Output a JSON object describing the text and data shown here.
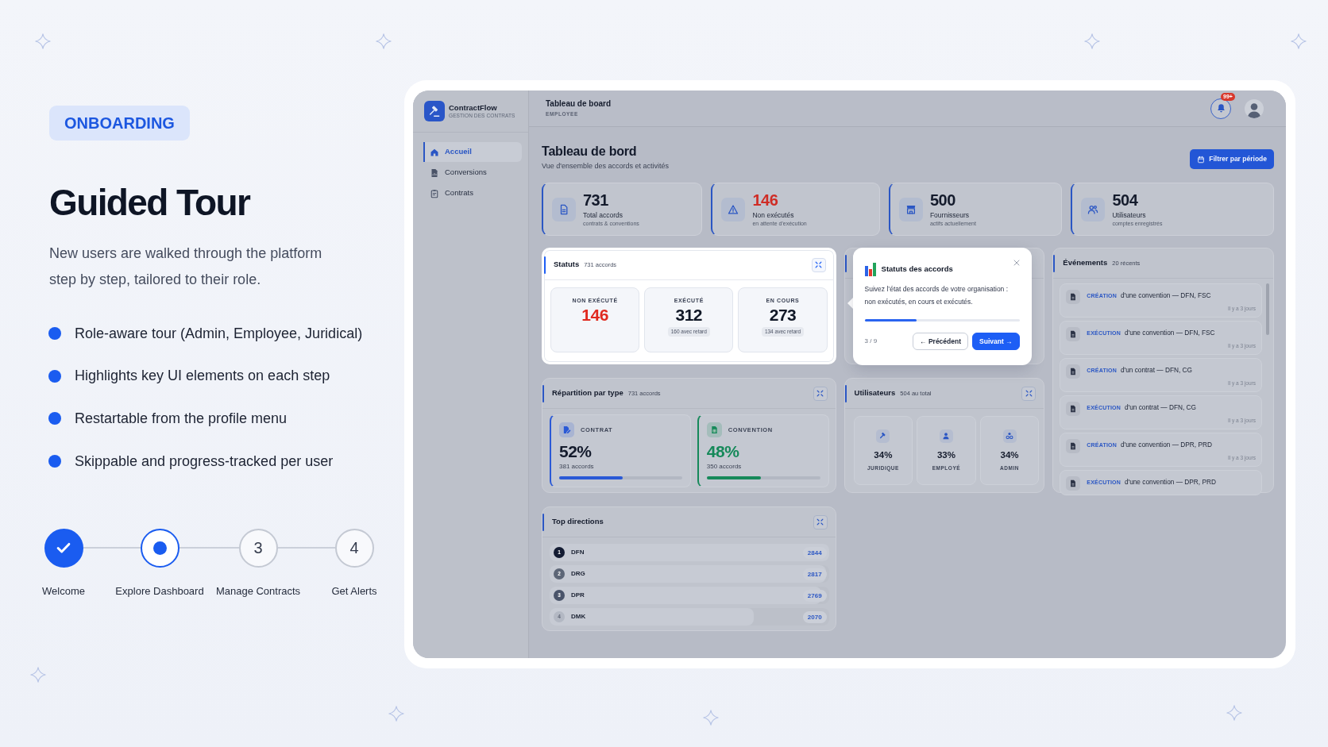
{
  "intro": {
    "badge": "ONBOARDING",
    "title": "Guided Tour",
    "description": "New users are walked through the platform step by step, tailored to their role.",
    "features": [
      "Role-aware tour (Admin, Employee, Juridical)",
      "Highlights key UI elements on each step",
      "Restartable from the profile menu",
      "Skippable and progress-tracked per user"
    ]
  },
  "steps": [
    {
      "label": "Welcome",
      "done": true,
      "current": false
    },
    {
      "label": "Explore Dashboard",
      "done": false,
      "current": true
    },
    {
      "number": "3",
      "label": "Manage Contracts",
      "done": false,
      "current": false
    },
    {
      "number": "4",
      "label": "Get Alerts",
      "done": false,
      "current": false
    }
  ],
  "app": {
    "brand": {
      "name": "ContractFlow",
      "tagline": "GESTION DES CONTRATS"
    },
    "nav": [
      {
        "label": "Accueil",
        "selected": true
      },
      {
        "label": "Conversions",
        "selected": false
      },
      {
        "label": "Contrats",
        "selected": false
      }
    ],
    "header": {
      "title": "Tableau de board",
      "role": "EMPLOYEE",
      "notifications": "99+"
    },
    "page": {
      "title": "Tableau de bord",
      "subtitle": "Vue d'ensemble des accords et activités",
      "filter_button": "Filtrer par période"
    },
    "kpis": [
      {
        "value": "731",
        "label": "Total accords",
        "note": "contrats & conventions",
        "alert": false
      },
      {
        "value": "146",
        "label": "Non exécutés",
        "note": "en attente d'exécution",
        "alert": true
      },
      {
        "value": "500",
        "label": "Fournisseurs",
        "note": "actifs actuellement",
        "alert": false
      },
      {
        "value": "504",
        "label": "Utilisateurs",
        "note": "comptes enregistrés",
        "alert": false
      }
    ],
    "statuts": {
      "title": "Statuts",
      "count": "731 accords",
      "highlighted": true,
      "items": [
        {
          "label": "NON EXÉCUTÉ",
          "value": "146",
          "alert": true
        },
        {
          "label": "EXÉCUTÉ",
          "value": "312",
          "note": "160 avec retard",
          "alert": false
        },
        {
          "label": "EN COURS",
          "value": "273",
          "note": "134 avec retard",
          "alert": false
        }
      ]
    },
    "tour_tooltip": {
      "title": "Statuts des accords",
      "text": "Suivez l’état des accords de votre organisation : non exécutés, en cours et exécutés.",
      "level": 0.333,
      "progress": "3 / 9",
      "buttons": [
        {
          "label": "← Précédent",
          "kind": "secondary"
        },
        {
          "label": "Suivant →",
          "kind": "primary"
        }
      ]
    },
    "repartition": {
      "title": "Répartition par type",
      "count": "731 accords",
      "items": [
        {
          "label": "CONTRAT",
          "percent": "52%",
          "count": "381 accords",
          "level": 0.52,
          "color": "#2a59d6",
          "value_accent": false
        },
        {
          "label": "CONVENTION",
          "percent": "48%",
          "count": "350 accords",
          "level": 0.48,
          "color": "#16895a",
          "value_accent": true
        }
      ]
    },
    "utilisateurs": {
      "title": "Utilisateurs",
      "count": "504 au total",
      "items": [
        {
          "percent": "34%",
          "label": "JURIDIQUE"
        },
        {
          "percent": "33%",
          "label": "EMPLOYÉ"
        },
        {
          "percent": "34%",
          "label": "ADMIN"
        }
      ]
    },
    "events": {
      "title": "Événements",
      "count": "20 récents",
      "items": [
        {
          "type": "CRÉATION",
          "text": "d'une convention — DFN, FSC",
          "time": "Il y a 3 jours"
        },
        {
          "type": "EXÉCUTION",
          "text": "d'une convention — DFN, FSC",
          "time": "Il y a 3 jours"
        },
        {
          "type": "CRÉATION",
          "text": "d'un contrat — DFN, CG",
          "time": "Il y a 3 jours"
        },
        {
          "type": "EXÉCUTION",
          "text": "d'un contrat — DFN, CG",
          "time": "Il y a 3 jours"
        },
        {
          "type": "CRÉATION",
          "text": "d'une convention — DPR, PRD",
          "time": "Il y a 3 jours"
        },
        {
          "type": "EXÉCUTION",
          "text": "d'une convention — DPR, PRD"
        }
      ]
    },
    "top_directions": {
      "title": "Top directions",
      "items": [
        {
          "rank": "1",
          "name": "DFN",
          "value": "2844",
          "level": 1,
          "color": "#141c33"
        },
        {
          "rank": "2",
          "name": "DRG",
          "value": "2817",
          "level": 0.99,
          "color": "#5d6677"
        },
        {
          "rank": "3",
          "name": "DPR",
          "value": "2769",
          "level": 0.974,
          "color": "#4a546a"
        },
        {
          "rank": "4",
          "name": "DMK",
          "value": "2070",
          "level": 0.73,
          "color": "#b3b8c3"
        }
      ]
    }
  }
}
